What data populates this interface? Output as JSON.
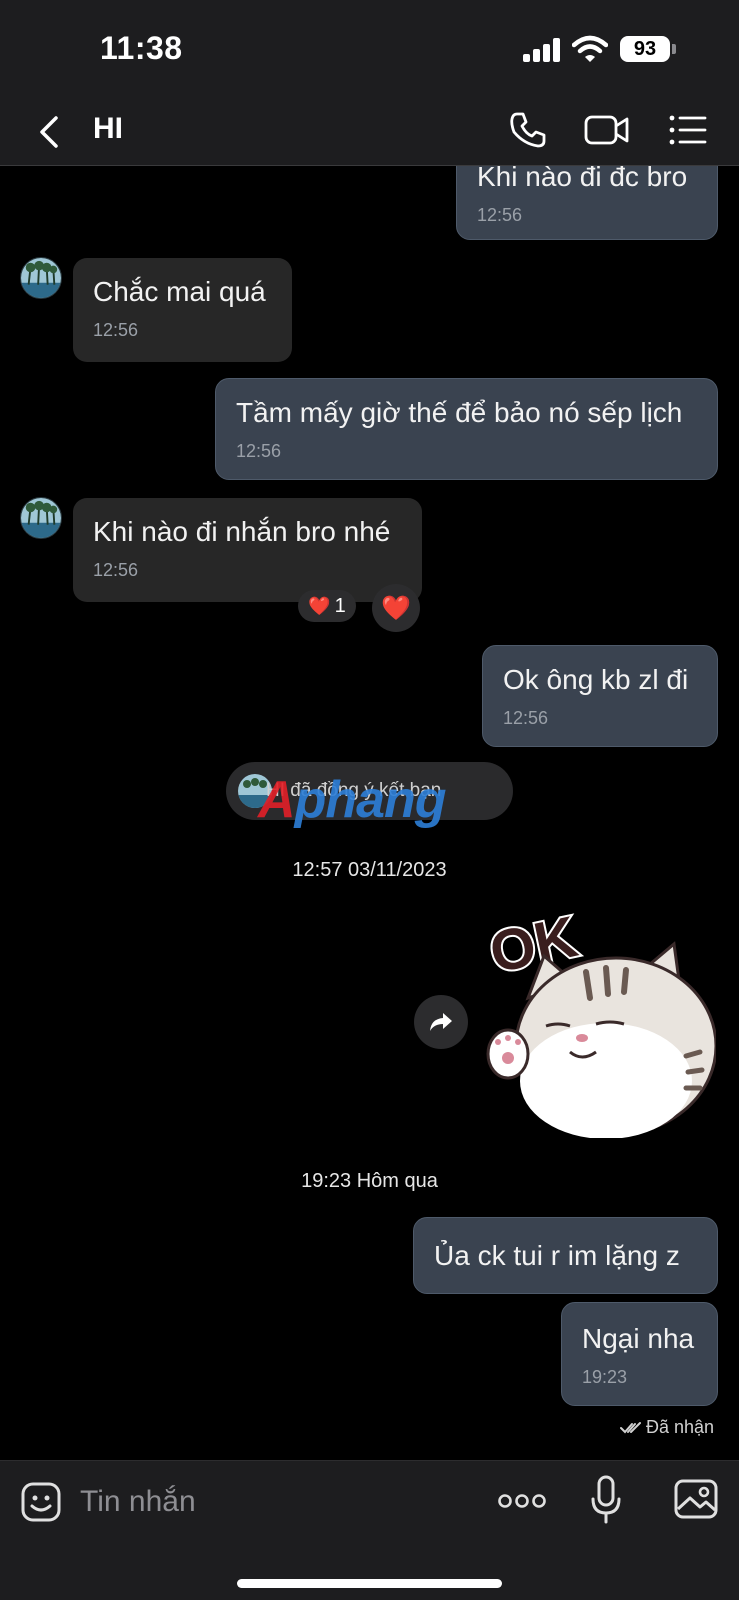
{
  "status_bar": {
    "time": "11:38",
    "battery": "93"
  },
  "header": {
    "title": "HI",
    "icons": [
      "back-icon",
      "phone-icon",
      "video-camera-icon",
      "list-menu-icon"
    ]
  },
  "messages": [
    {
      "dir": "out",
      "text": "Khi nào đi đc bro",
      "time": "12:56"
    },
    {
      "dir": "in",
      "text": "Chắc mai quá",
      "time": "12:56"
    },
    {
      "dir": "out",
      "text": "Tầm mấy giờ thế để bảo nó sếp lịch",
      "time": "12:56"
    },
    {
      "dir": "in",
      "text": "Khi nào đi nhắn bro nhé",
      "time": "12:56"
    },
    {
      "dir": "out",
      "text": "Ok ông kb zl đi",
      "time": "12:56"
    },
    {
      "dir": "out",
      "text": "Ủa ck tui r im lặng z",
      "time": ""
    },
    {
      "dir": "out",
      "text": "Ngại nha",
      "time": "19:23"
    }
  ],
  "reaction": {
    "emoji": "❤️",
    "count": "1",
    "button_emoji": "❤️"
  },
  "system_notice": {
    "text": "HI đã đồng ý kết bạn"
  },
  "watermark": {
    "first": "A",
    "rest": "phang"
  },
  "dividers": {
    "first": "12:57 03/11/2023",
    "second": "19:23 Hôm qua"
  },
  "sticker": {
    "text": "OK",
    "description_icon": "ok-cat-sticker"
  },
  "receipt": {
    "text": "Đã nhận"
  },
  "composer": {
    "placeholder": "Tin nhắn"
  },
  "colors": {
    "background": "#000000",
    "bar": "#1d1d1f",
    "outgoing_bubble": "#3a4350",
    "incoming_bubble": "#272727",
    "watermark_red": "#e32028",
    "watermark_blue": "#2d7fd8"
  }
}
